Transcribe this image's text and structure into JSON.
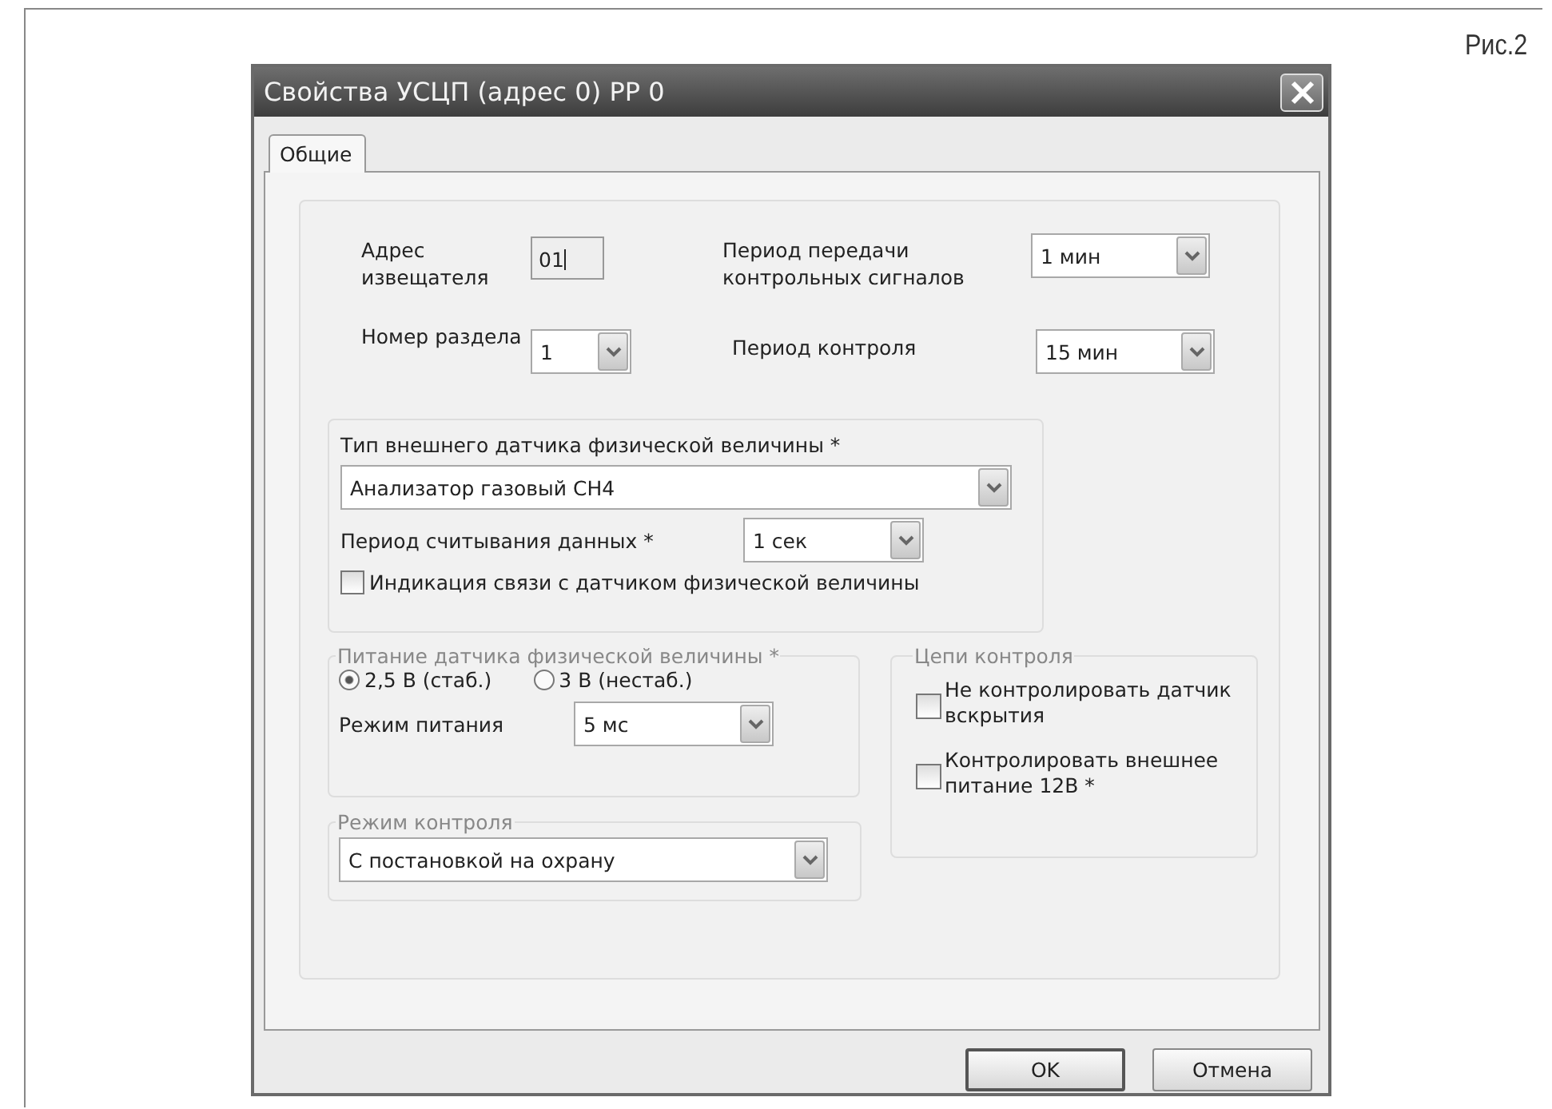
{
  "caption": "Рис.2",
  "window": {
    "title": "Свойства УСЦП (адрес 0) РР 0"
  },
  "tabs": [
    {
      "label": "Общие",
      "selected": true
    }
  ],
  "address": {
    "label": "Адрес извещателя",
    "value": "01"
  },
  "section": {
    "label": "Номер раздела",
    "value": "1"
  },
  "transmit_period": {
    "label": "Период передачи контрольных сигналов",
    "value": "1 мин"
  },
  "control_period": {
    "label": "Период контроля",
    "value": "15 мин"
  },
  "sensor_group": {
    "title": "Тип внешнего датчика физической величины *",
    "type_value": "Анализатор газовый СН4",
    "read_period": {
      "label": "Период считывания данных *",
      "value": "1 сек"
    },
    "link_indication": {
      "label": "Индикация связи с датчиком физической величины",
      "checked": false
    }
  },
  "power_group": {
    "title": "Питание датчика физической величины *",
    "options": [
      {
        "label": "2,5 В (стаб.)",
        "selected": true
      },
      {
        "label": "3 В (нестаб.)",
        "selected": false
      }
    ],
    "mode": {
      "label": "Режим питания",
      "value": "5 мс"
    }
  },
  "control_mode_group": {
    "title": "Режим контроля",
    "value": "С постановкой на охрану"
  },
  "circuits_group": {
    "title": "Цепи контроля",
    "options": [
      {
        "label": "Не контролировать датчик вскрытия",
        "checked": false
      },
      {
        "label": "Контролировать внешнее питание 12В *",
        "checked": false
      }
    ]
  },
  "buttons": [
    {
      "label": "OK",
      "default": true
    },
    {
      "label": "Отмена",
      "default": false
    }
  ]
}
